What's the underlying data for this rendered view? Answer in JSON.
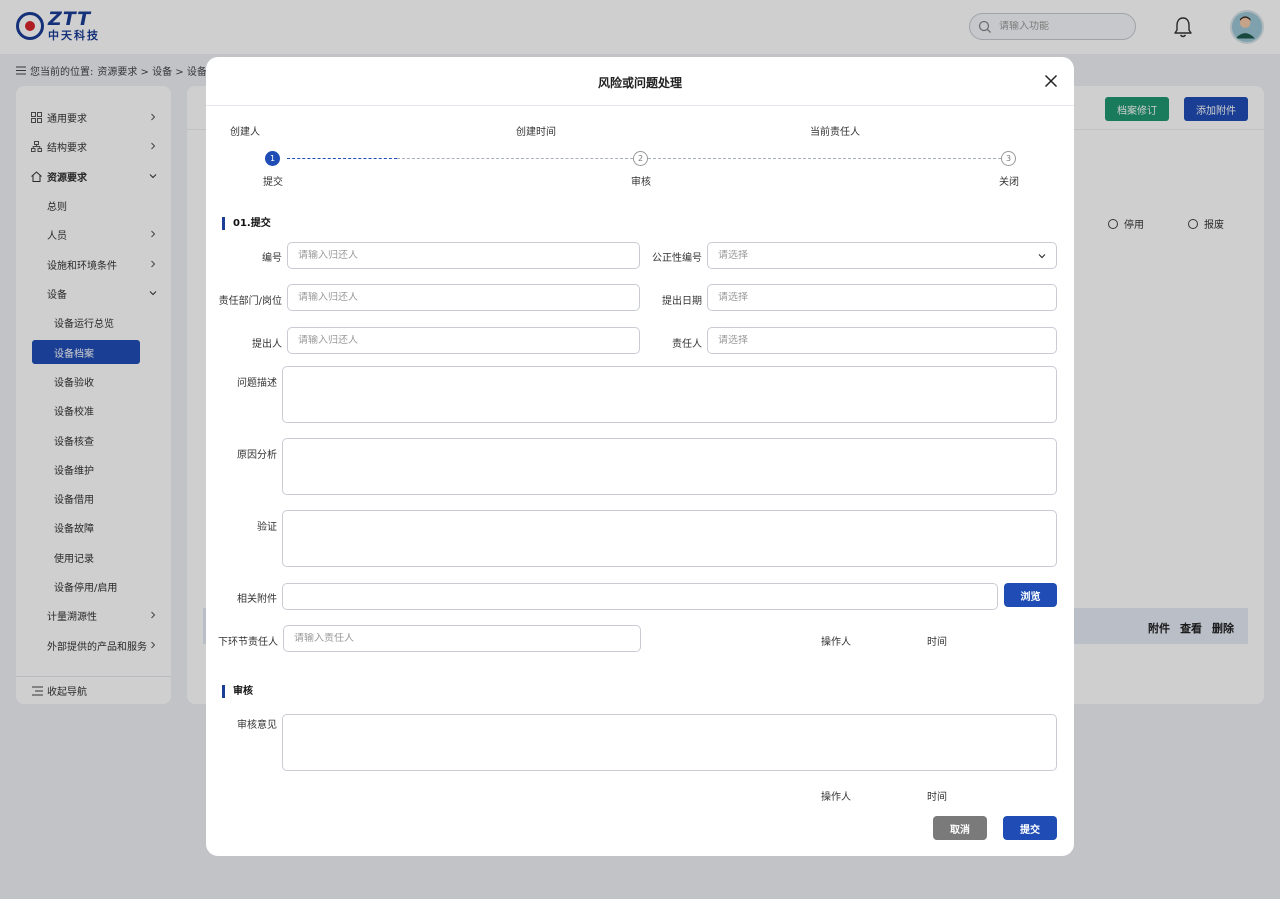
{
  "header": {
    "logo_brand": "ZTT",
    "logo_subtitle": "中天科技",
    "search_placeholder": "请输入功能"
  },
  "breadcrumb": {
    "prefix": "您当前的位置:",
    "path": "资源要求 > 设备 > 设备档案"
  },
  "sidebar": {
    "items": [
      {
        "label": "通用要求",
        "icon": "grid-icon",
        "has_arrow": true
      },
      {
        "label": "结构要求",
        "icon": "org-icon",
        "has_arrow": true
      },
      {
        "label": "资源要求",
        "icon": "home-icon",
        "expanded": true
      },
      {
        "label": "总则"
      },
      {
        "label": "人员",
        "has_arrow": true
      },
      {
        "label": "设施和环境条件",
        "has_arrow": true
      },
      {
        "label": "设备",
        "expanded": true
      },
      {
        "label": "设备运行总览"
      },
      {
        "label": "设备档案",
        "active": true
      },
      {
        "label": "设备验收"
      },
      {
        "label": "设备校准"
      },
      {
        "label": "设备核查"
      },
      {
        "label": "设备维护"
      },
      {
        "label": "设备借用"
      },
      {
        "label": "设备故障"
      },
      {
        "label": "使用记录"
      },
      {
        "label": "设备停用/启用"
      },
      {
        "label": "计量溯源性",
        "has_arrow": true
      },
      {
        "label": "外部提供的产品和服务",
        "has_arrow": true
      }
    ],
    "collapse_label": "收起导航"
  },
  "main": {
    "btn_revise": "档案修订",
    "btn_attach": "添加附件",
    "radio_disabled": "停用",
    "radio_scrap": "报废",
    "table_cols": {
      "attach": "附件",
      "view": "查看",
      "delete": "删除"
    }
  },
  "modal": {
    "title": "风险或问题处理",
    "meta": {
      "creator": "创建人",
      "created_time": "创建时间",
      "owner": "当前责任人"
    },
    "steps": [
      {
        "num": "1",
        "label": "提交",
        "state": "active"
      },
      {
        "num": "2",
        "label": "审核",
        "state": "pending"
      },
      {
        "num": "3",
        "label": "关闭",
        "state": "pending"
      }
    ],
    "section_submit": "01.提交",
    "fields": {
      "code_label": "编号",
      "code_placeholder": "请输入归还人",
      "fair_code_label": "公正性编号",
      "fair_code_placeholder": "请选择",
      "dept_label": "责任部门/岗位",
      "dept_placeholder": "请输入归还人",
      "date_label": "提出日期",
      "date_placeholder": "请选择",
      "proposer_label": "提出人",
      "proposer_placeholder": "请输入归还人",
      "resp_label": "责任人",
      "resp_placeholder": "请选择",
      "desc_label": "问题描述",
      "cause_label": "原因分析",
      "verify_label": "验证",
      "attach_label": "相关附件",
      "browse_label": "浏览",
      "next_label": "下环节责任人",
      "next_placeholder": "请输入责任人",
      "operator_label": "操作人",
      "time_label": "时间"
    },
    "section_review": "审核",
    "review": {
      "opinion_label": "审核意见",
      "operator_label": "操作人",
      "time_label": "时间"
    },
    "cancel_label": "取消",
    "submit_label": "提交"
  }
}
